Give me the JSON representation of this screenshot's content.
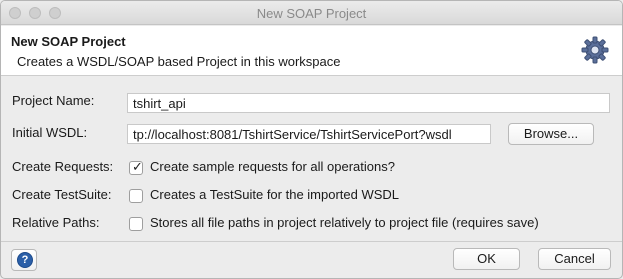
{
  "window": {
    "title": "New SOAP Project"
  },
  "header": {
    "title": "New SOAP Project",
    "description": "Creates a WSDL/SOAP based Project in this workspace",
    "icon": "gear-icon"
  },
  "form": {
    "project_name_label": "Project Name:",
    "project_name_value": "tshirt_api",
    "initial_wsdl_label": "Initial WSDL:",
    "initial_wsdl_value": "tp://localhost:8081/TshirtService/TshirtServicePort?wsdl",
    "browse_label": "Browse...",
    "create_requests_label": "Create Requests:",
    "create_requests_text": "Create sample requests for all operations?",
    "create_requests_checked": true,
    "create_testsuite_label": "Create TestSuite:",
    "create_testsuite_text": "Creates a TestSuite for the imported WSDL",
    "create_testsuite_checked": false,
    "relative_paths_label": "Relative Paths:",
    "relative_paths_text": "Stores all file paths in project relatively to project file (requires save)",
    "relative_paths_checked": false
  },
  "footer": {
    "help_icon": "help-icon",
    "ok_label": "OK",
    "cancel_label": "Cancel"
  },
  "colors": {
    "help_blue": "#2b5fa8"
  }
}
